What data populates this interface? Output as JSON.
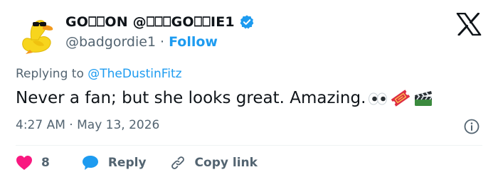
{
  "author": {
    "display_name": "GO⎕⎕ON @⎕⎕⎕GO⎕⎕IE1",
    "handle": "@badgordie1",
    "separator": "·",
    "follow_label": "Follow",
    "avatar_icon": "duck-with-sunglasses-icon",
    "verified_icon": "verified-badge-icon",
    "verified_color": "#1d9bf0"
  },
  "platform": {
    "logo_icon": "x-logo-icon"
  },
  "reply_context": {
    "prefix": "Replying to",
    "mention": "@TheDustinFitz"
  },
  "tweet": {
    "text": "Never a fan; but she looks great. Amazing.",
    "emojis": [
      "eyes-icon",
      "ticket-icon",
      "clapper-board-icon"
    ]
  },
  "meta": {
    "time": "4:27 AM",
    "separator": "·",
    "date": "May 13, 2026",
    "info_icon": "info-icon"
  },
  "actions": {
    "like_count": "8",
    "reply_label": "Reply",
    "copy_link_label": "Copy link",
    "like_color": "#f91880",
    "reply_color": "#1d9bf0"
  },
  "colors": {
    "text": "#0f1419",
    "secondary": "#536471",
    "accent": "#1d9bf0"
  }
}
